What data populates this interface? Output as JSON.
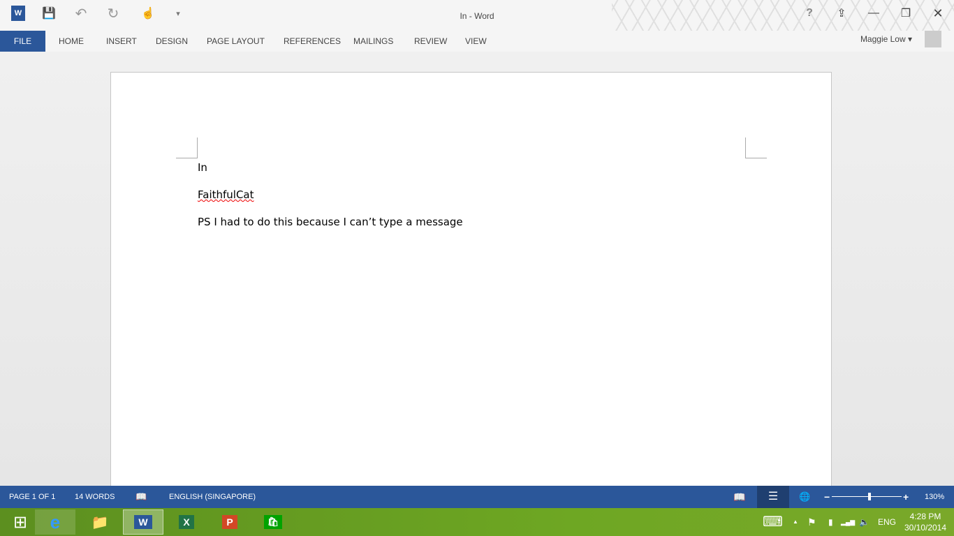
{
  "title": "In - Word",
  "qat": {
    "word": "W",
    "save": "💾",
    "undo": "↶",
    "redo": "↻",
    "touch": "☝",
    "customize": "▾"
  },
  "window": {
    "help": "?",
    "ribbon_options": "⇪",
    "minimize": "—",
    "restore": "❐",
    "close": "✕"
  },
  "tabs": [
    "FILE",
    "HOME",
    "INSERT",
    "DESIGN",
    "PAGE LAYOUT",
    "REFERENCES",
    "MAILINGS",
    "REVIEW",
    "VIEW"
  ],
  "user": "Maggie Low ▾",
  "document": {
    "paragraphs": [
      "In",
      "FaithfulCat",
      "PS I had to do this because I can’t type a message"
    ]
  },
  "status": {
    "page": "PAGE 1 OF 1",
    "words": "14 WORDS",
    "proof": "📖",
    "language": "ENGLISH (SINGAPORE)",
    "zoom": "130%",
    "zoom_percent": 130,
    "read_mode": "📖",
    "print_layout": "☰",
    "web_layout": "🌐",
    "zoom_out": "−",
    "zoom_in": "+"
  },
  "taskbar": {
    "start": "⊞",
    "ie": "e",
    "explorer": "📁",
    "word": "W",
    "excel": "X",
    "powerpoint": "P",
    "store": "🛍",
    "keyboard": "⌨",
    "show_hidden": "▲",
    "flag": "⚑",
    "battery": "▮",
    "signal": "▂▄▆",
    "volume": "🔈",
    "lang": "ENG",
    "time": "4:28 PM",
    "date": "30/10/2014"
  }
}
